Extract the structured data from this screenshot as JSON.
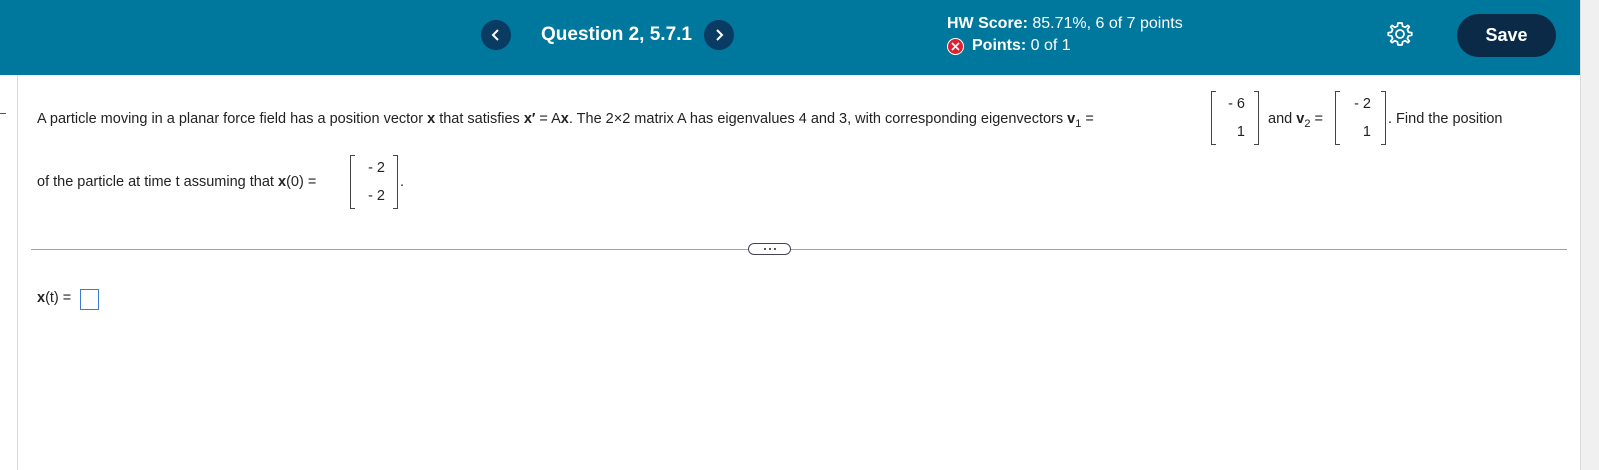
{
  "header": {
    "question_title": "Question 2, 5.7.1",
    "hw_score_label": "HW Score:",
    "hw_score_value": "85.71%, 6 of 7 points",
    "points_label": "Points:",
    "points_value": "0 of 1",
    "save_label": "Save",
    "prev_icon": "chevron-left-icon",
    "next_icon": "chevron-right-icon",
    "settings_icon": "gear-icon",
    "status_icon": "x-circle-icon",
    "accent_color": "#00779d",
    "dark_color": "#0a2a47",
    "error_color": "#e02030"
  },
  "problem": {
    "p1": "A particle moving in a planar force field has a position vector ",
    "x_bold": "x",
    "p2": " that satisfies ",
    "xprime": "x′",
    "p3": " = A",
    "x_bold2": "x",
    "p4": ". The 2×2 matrix A has eigenvalues 4 and 3, with corresponding eigenvectors ",
    "v1_label": "v",
    "v1_sub": "1",
    "eq": " =",
    "v1": [
      "- 6",
      "1"
    ],
    "and": "and ",
    "v2_label": "v",
    "v2_sub": "2",
    "eq2": " =",
    "v2": [
      "- 2",
      "1"
    ],
    "p5": ". Find the position",
    "line2": "of the particle at time t assuming that ",
    "x0_bold": "x",
    "x0_rest": "(0) =",
    "x0": [
      "- 2",
      "- 2"
    ],
    "period": "."
  },
  "answer": {
    "label_bold": "x",
    "label_rest": "(t) ="
  }
}
